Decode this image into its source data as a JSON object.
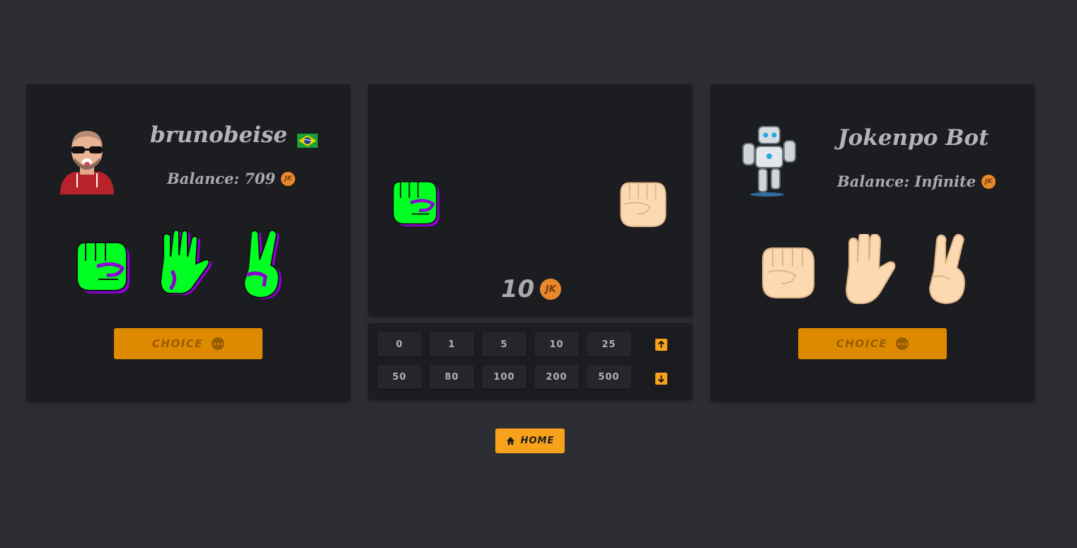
{
  "player": {
    "name": "brunobeise",
    "flag_icon": "brazil-flag-icon",
    "balance_label": "Balance: 709",
    "coin_label": "JK",
    "hands": [
      "rock",
      "paper",
      "scissors"
    ],
    "hand_colors": {
      "primary": "#00ff22",
      "secondary": "#8f00d6"
    },
    "choice_label": "CHOICE"
  },
  "bot": {
    "name": "Jokenpo Bot",
    "balance_label": "Balance: Infinite",
    "coin_label": "JK",
    "hands": [
      "rock",
      "paper",
      "scissors"
    ],
    "hand_color": "#fcd9b0",
    "choice_label": "CHOICE"
  },
  "arena": {
    "player_hand": "rock",
    "bot_hand": "rock",
    "bet_value": "10",
    "coin_label": "JK"
  },
  "bet_options": [
    "0",
    "1",
    "5",
    "10",
    "25",
    "50",
    "80",
    "100",
    "200",
    "500"
  ],
  "controls": {
    "increase_icon": "arrow-up-icon",
    "decrease_icon": "arrow-down-icon"
  },
  "home": {
    "label": "HOME",
    "icon": "home-icon"
  },
  "colors": {
    "background": "#2d2e33",
    "panel": "#1c1d21",
    "accent": "#f7a21b",
    "choice_button": "#dd8a00",
    "coin": "#e8882d"
  }
}
